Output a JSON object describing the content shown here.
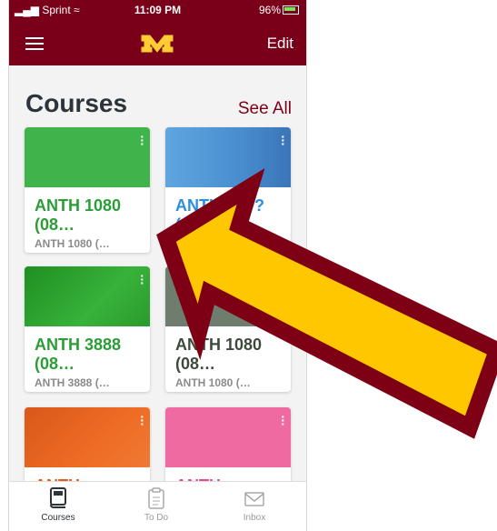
{
  "status_bar": {
    "carrier": "Sprint",
    "time": "11:09 PM",
    "battery": "96%"
  },
  "nav": {
    "edit_label": "Edit"
  },
  "courses": {
    "heading": "Courses",
    "see_all": "See All",
    "cards": [
      {
        "code": "ANTH 1080 (08…",
        "subtitle": "ANTH 1080 (…",
        "color": "#3eb44a",
        "text_color": "#2a9d36"
      },
      {
        "code": "ANTH 3??? (0…",
        "subtitle": "",
        "color": "#3d8fd6",
        "text_color": "#2c8ee0"
      },
      {
        "code": "ANTH 3888 (08…",
        "subtitle": "ANTH 3888 (…",
        "color": "#2aa52a",
        "text_color": "#2a9d36"
      },
      {
        "code": "ANTH 1080 (08…",
        "subtitle": "ANTH 1080 (…",
        "color": "#6f7d6e",
        "text_color": "#3d4a3c"
      },
      {
        "code": "ANTH",
        "subtitle": "",
        "color": "#ee6c24",
        "text_color": "#e25a1c"
      },
      {
        "code": "ANTH",
        "subtitle": "",
        "color": "#ef6aa0",
        "text_color": "#e24a8c"
      }
    ]
  },
  "tabs": [
    {
      "label": "Courses",
      "active": true
    },
    {
      "label": "To Do",
      "active": false
    },
    {
      "label": "Inbox",
      "active": false
    }
  ]
}
